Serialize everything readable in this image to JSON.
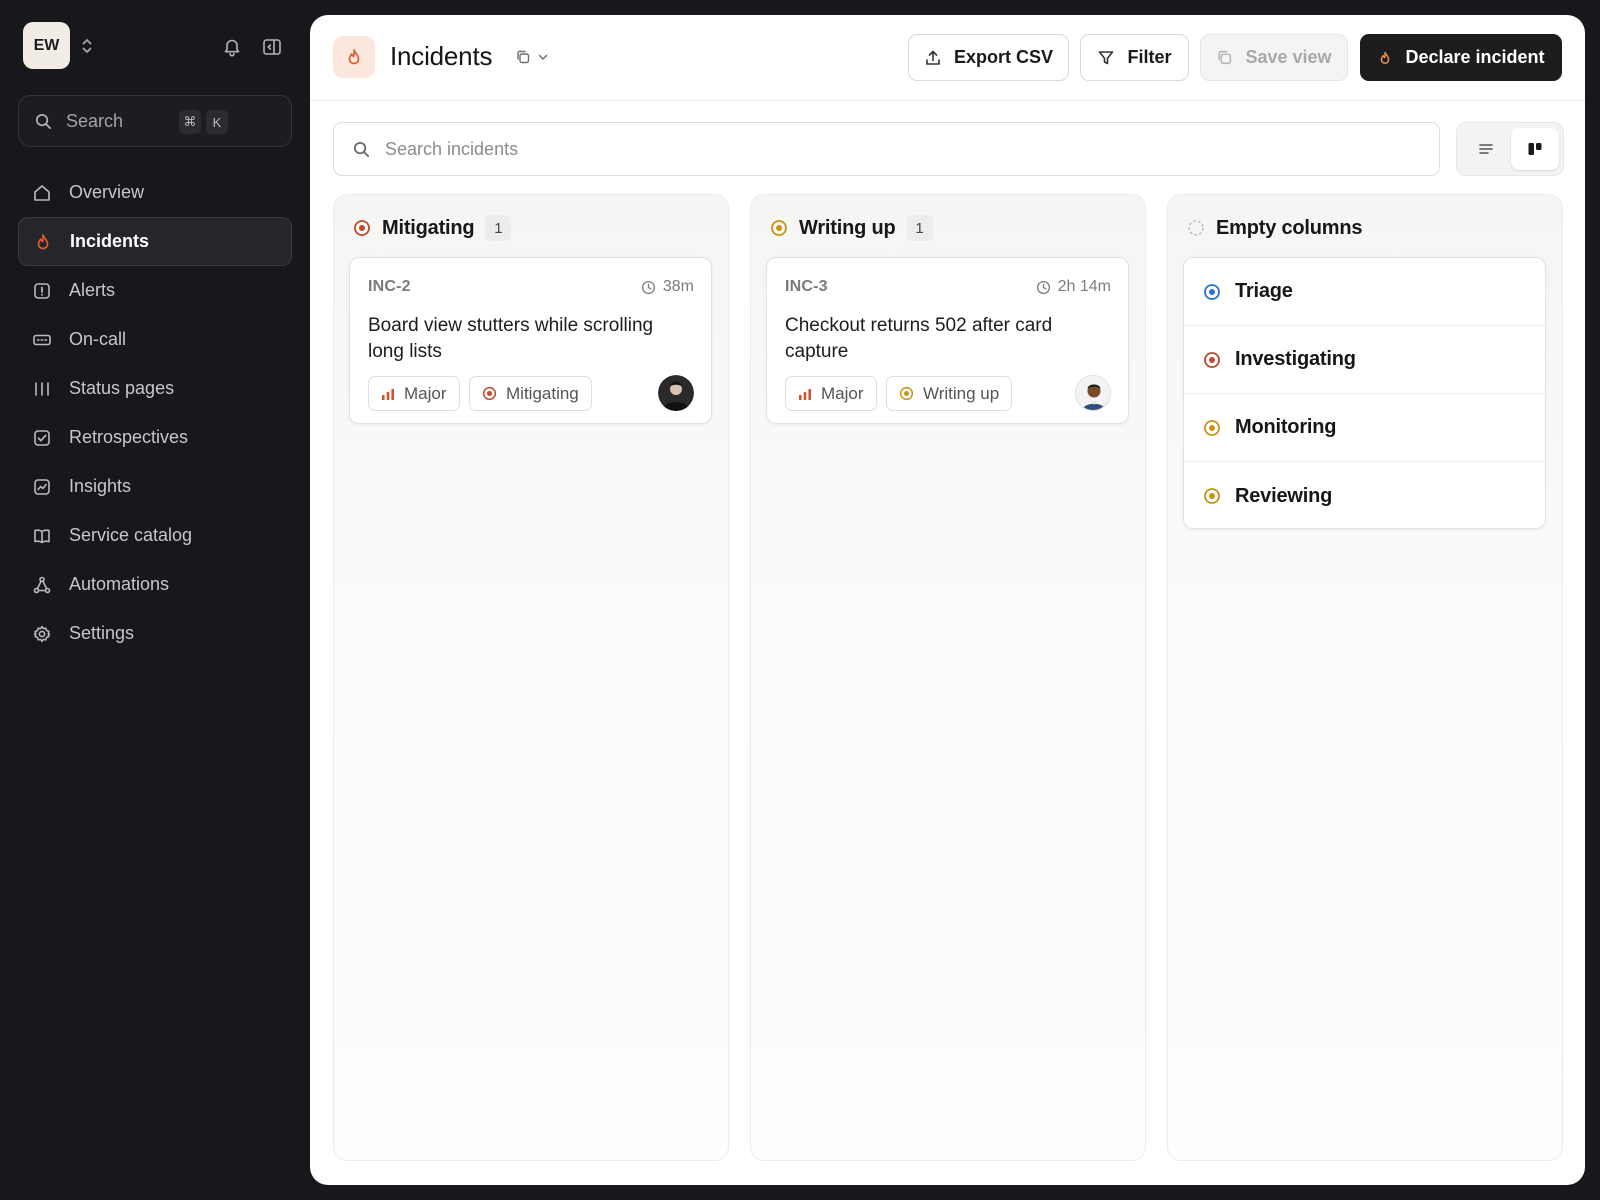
{
  "workspace": {
    "initials": "EW"
  },
  "sidebar": {
    "search": {
      "label": "Search",
      "shortcut_mod": "⌘",
      "shortcut_key": "K"
    },
    "items": [
      {
        "label": "Overview",
        "icon": "home-icon"
      },
      {
        "label": "Incidents",
        "icon": "flame-icon",
        "active": true
      },
      {
        "label": "Alerts",
        "icon": "alert-icon"
      },
      {
        "label": "On-call",
        "icon": "pager-icon"
      },
      {
        "label": "Status pages",
        "icon": "status-bars-icon"
      },
      {
        "label": "Retrospectives",
        "icon": "checkbox-icon"
      },
      {
        "label": "Insights",
        "icon": "chart-icon"
      },
      {
        "label": "Service catalog",
        "icon": "book-icon"
      },
      {
        "label": "Automations",
        "icon": "workflow-icon"
      },
      {
        "label": "Settings",
        "icon": "gear-icon"
      }
    ]
  },
  "header": {
    "title": "Incidents",
    "export_label": "Export CSV",
    "filter_label": "Filter",
    "save_view_label": "Save view",
    "declare_label": "Declare incident"
  },
  "search_incidents": {
    "placeholder": "Search incidents"
  },
  "columns": [
    {
      "title": "Mitigating",
      "count": "1",
      "color": "#c0482b",
      "card": {
        "id": "INC-2",
        "time": "38m",
        "title": "Board view stutters while scrolling long lists",
        "severity": "Major",
        "status": "Mitigating"
      }
    },
    {
      "title": "Writing up",
      "count": "1",
      "color": "#c9921b",
      "card": {
        "id": "INC-3",
        "time": "2h 14m",
        "title": "Checkout returns 502 after card capture",
        "severity": "Major",
        "status": "Writing up"
      }
    }
  ],
  "empty_columns": {
    "title": "Empty columns",
    "items": [
      {
        "label": "Triage",
        "color": "#2f6fd6"
      },
      {
        "label": "Investigating",
        "color": "#c0482b"
      },
      {
        "label": "Monitoring",
        "color": "#c9921b"
      },
      {
        "label": "Reviewing",
        "color": "#c9921b"
      }
    ]
  },
  "colors": {
    "sidebar_bg": "#17171c",
    "accent": "#e05a2b",
    "severity_major": "#d0522e",
    "primary_button": "#1d1d1f"
  }
}
